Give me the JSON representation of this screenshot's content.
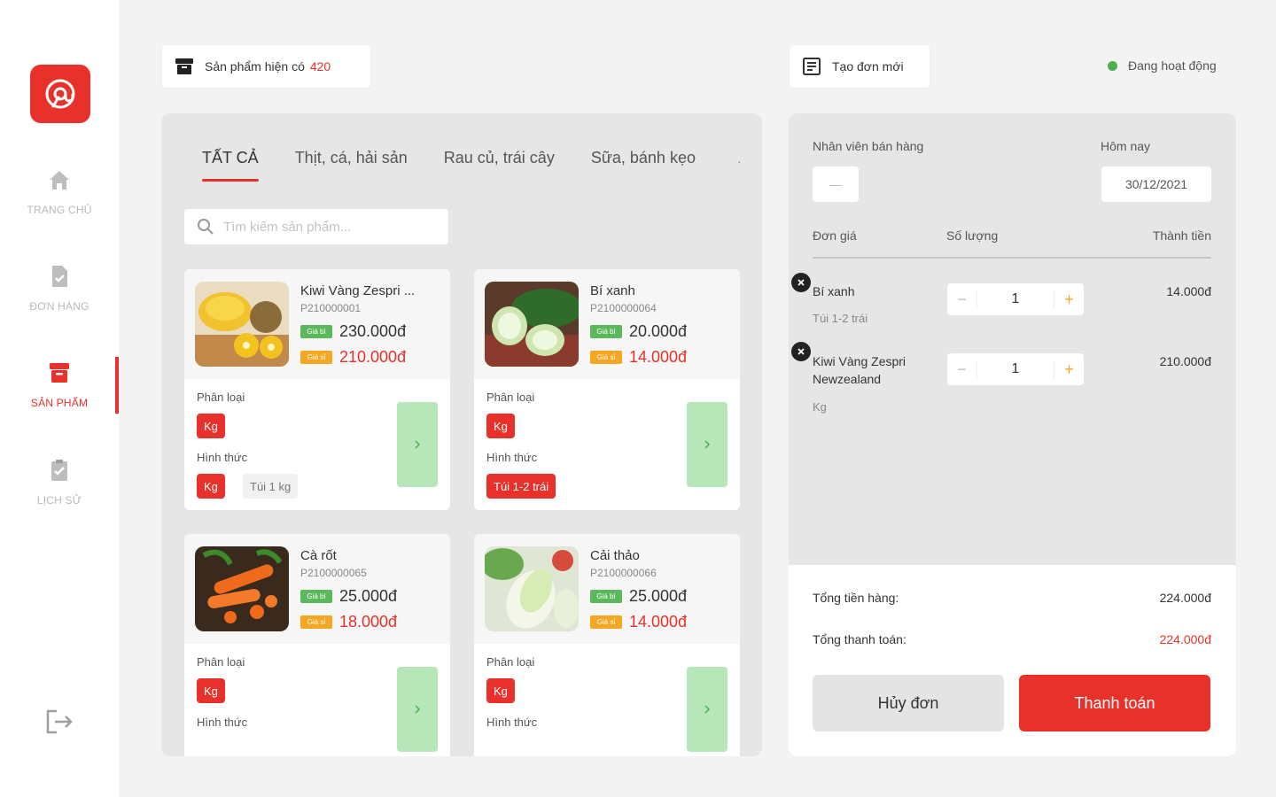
{
  "colors": {
    "accent": "#e8312a",
    "green": "#4caf50",
    "orange": "#f5a623"
  },
  "sidebar": {
    "items": [
      {
        "label": "TRANG CHỦ",
        "icon": "home-icon"
      },
      {
        "label": "ĐƠN HÀNG",
        "icon": "order-file-icon"
      },
      {
        "label": "SẢN PHẨM",
        "icon": "product-box-icon",
        "active": true
      },
      {
        "label": "LỊCH SỬ",
        "icon": "history-clipboard-icon"
      }
    ]
  },
  "header": {
    "products_label": "Sản phẩm hiện có",
    "products_count": "420",
    "new_order_label": "Tạo đơn mới",
    "status_text": "Đang hoạt động"
  },
  "catalog": {
    "tabs": [
      "TẤT CẢ",
      "Thịt, cá, hải sản",
      "Rau củ, trái cây",
      "Sữa, bánh kẹo"
    ],
    "tab_more": "·",
    "search_placeholder": "Tìm kiếm sản phẩm...",
    "section_labels": {
      "category": "Phân loại",
      "form": "Hình thức"
    },
    "price_badges": {
      "old": "Giá bì",
      "new": "Giá sỉ"
    },
    "products": [
      {
        "name": "Kiwi Vàng Zespri ...",
        "code": "P210000001",
        "price_old": "230.000đ",
        "price_new": "210.000đ",
        "category": "Kg",
        "forms": [
          "Kg",
          "Túi 1 kg"
        ]
      },
      {
        "name": "Bí xanh",
        "code": "P2100000064",
        "price_old": "20.000đ",
        "price_new": "14.000đ",
        "category": "Kg",
        "forms": [
          "Túi 1-2 trái"
        ]
      },
      {
        "name": "Cà rốt",
        "code": "P2100000065",
        "price_old": "25.000đ",
        "price_new": "18.000đ",
        "category": "Kg",
        "forms": []
      },
      {
        "name": "Cải thảo",
        "code": "P2100000066",
        "price_old": "25.000đ",
        "price_new": "14.000đ",
        "category": "Kg",
        "forms": []
      }
    ]
  },
  "order": {
    "staff_label": "Nhân viên bán hàng",
    "staff_value": "—",
    "date_label": "Hôm nay",
    "date_value": "30/12/2021",
    "columns": {
      "price": "Đơn giá",
      "qty": "Số lượng",
      "total": "Thành tiền"
    },
    "items": [
      {
        "name": "Bí xanh",
        "unit": "Túi 1-2 trái",
        "qty": "1",
        "total": "14.000đ"
      },
      {
        "name": "Kiwi Vàng Zespri Newzealand",
        "unit": "Kg",
        "qty": "1",
        "total": "210.000đ"
      }
    ],
    "subtotal_label": "Tổng tiền hàng:",
    "subtotal_value": "224.000đ",
    "grand_total_label": "Tổng thanh toán:",
    "grand_total_value": "224.000đ",
    "cancel_label": "Hủy đơn",
    "pay_label": "Thanh toán"
  }
}
